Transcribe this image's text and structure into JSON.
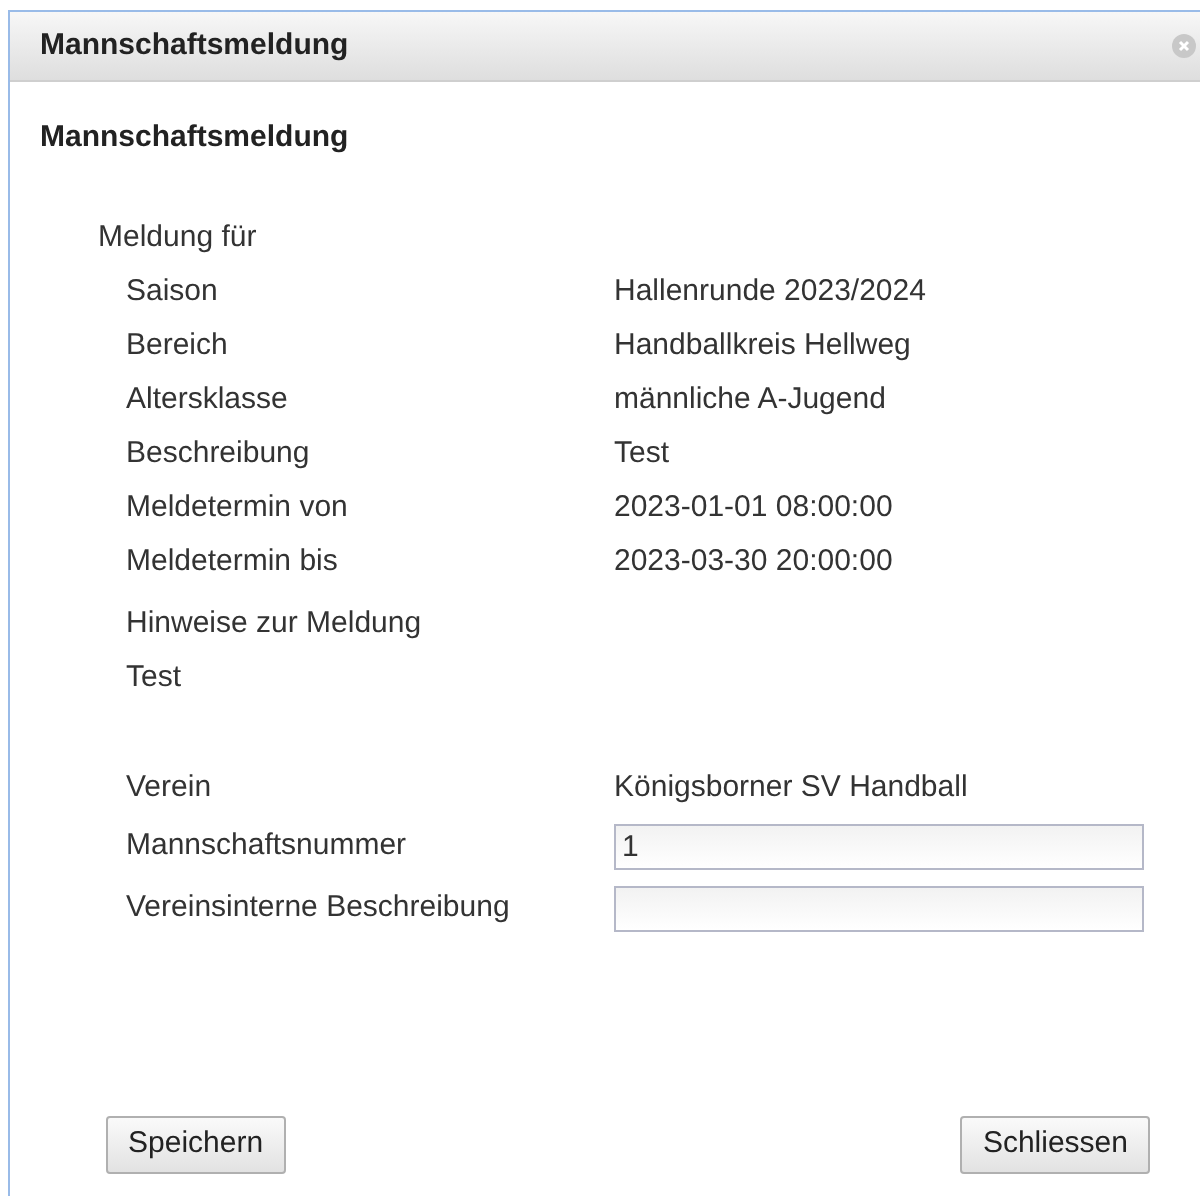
{
  "window": {
    "title": "Mannschaftsmeldung"
  },
  "heading": "Mannschaftsmeldung",
  "section_label": "Meldung für",
  "info_rows": [
    {
      "label": "Saison",
      "value": "Hallenrunde 2023/2024"
    },
    {
      "label": "Bereich",
      "value": "Handballkreis Hellweg"
    },
    {
      "label": "Altersklasse",
      "value": "männliche A-Jugend"
    },
    {
      "label": "Beschreibung",
      "value": "Test"
    },
    {
      "label": "Meldetermin von",
      "value": "2023-01-01 08:00:00"
    },
    {
      "label": "Meldetermin bis",
      "value": "2023-03-30 20:00:00"
    }
  ],
  "notes_label": "Hinweise zur Meldung",
  "notes_text": "Test",
  "club": {
    "label": "Verein",
    "value": "Königsborner SV Handball"
  },
  "fields": [
    {
      "label": "Mannschaftsnummer",
      "value": "1"
    },
    {
      "label": "Vereinsinterne Beschreibung"
    }
  ],
  "buttons": [
    "Speichern",
    "Schliessen"
  ]
}
